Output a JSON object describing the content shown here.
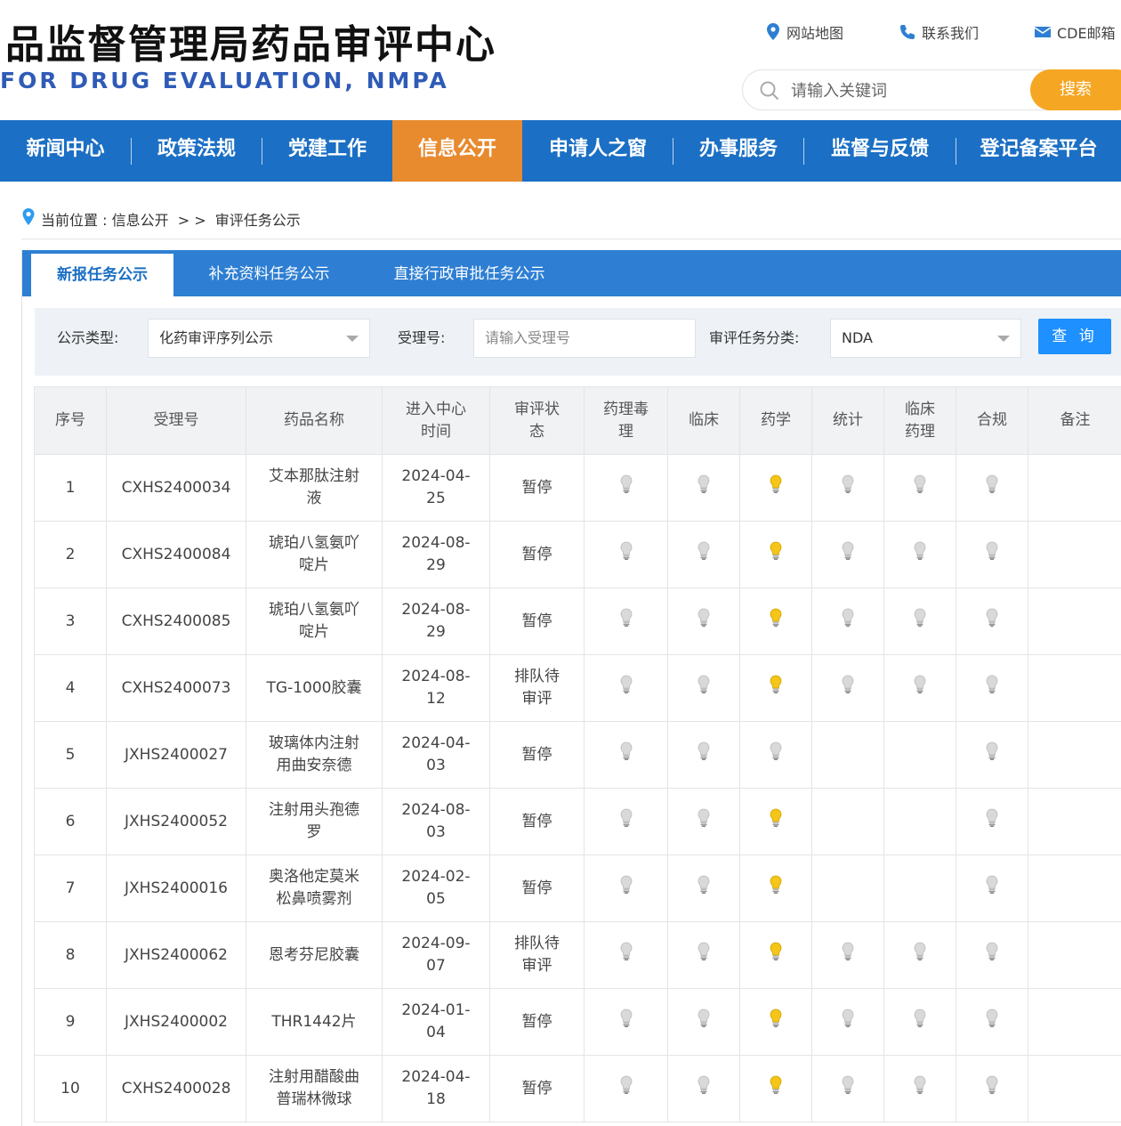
{
  "header": {
    "title_cn": "品监督管理局药品审评中心",
    "title_en": "FOR DRUG EVALUATION, NMPA",
    "links": {
      "sitemap": "网站地图",
      "contact": "联系我们",
      "mail": "CDE邮箱"
    },
    "search_placeholder": "请输入关键词",
    "search_button": "搜索"
  },
  "nav": {
    "items": [
      "新闻中心",
      "政策法规",
      "党建工作",
      "信息公开",
      "申请人之窗",
      "办事服务",
      "监督与反馈",
      "登记备案平台"
    ],
    "active": "信息公开"
  },
  "breadcrumb": {
    "text": "当前位置 : 信息公开  > >  审评任务公示"
  },
  "tabs": {
    "items": [
      "新报任务公示",
      "补充资料任务公示",
      "直接行政审批任务公示"
    ],
    "active": "新报任务公示"
  },
  "filter": {
    "type_label": "公示类型:",
    "type_value": "化药审评序列公示",
    "acceptance_label": "受理号:",
    "acceptance_placeholder": "请输入受理号",
    "category_label": "审评任务分类:",
    "category_value": "NDA",
    "query_button": "查 询"
  },
  "colors": {
    "nav_blue": "#1b6fc4",
    "nav_active": "#e88a2e",
    "search_button": "#f5a623",
    "bulb_on": "#f5c518",
    "bulb_off": "#d9d9d9"
  },
  "table": {
    "headers": [
      "序号",
      "受理号",
      "药品名称",
      "进入中心\n时间",
      "审评状\n态",
      "药理毒\n理",
      "临床",
      "药学",
      "统计",
      "临床\n药理",
      "合规",
      "备注"
    ],
    "rows": [
      {
        "no": "1",
        "id": "CXHS2400034",
        "name": "艾本那肽注射\n液",
        "date": "2024-04-\n25",
        "status": "暂停",
        "bulbs": [
          "off",
          "off",
          "on",
          "off",
          "off",
          "off"
        ],
        "note": ""
      },
      {
        "no": "2",
        "id": "CXHS2400084",
        "name": "琥珀八氢氨吖\n啶片",
        "date": "2024-08-\n29",
        "status": "暂停",
        "bulbs": [
          "off",
          "off",
          "on",
          "off",
          "off",
          "off"
        ],
        "note": ""
      },
      {
        "no": "3",
        "id": "CXHS2400085",
        "name": "琥珀八氢氨吖\n啶片",
        "date": "2024-08-\n29",
        "status": "暂停",
        "bulbs": [
          "off",
          "off",
          "on",
          "off",
          "off",
          "off"
        ],
        "note": ""
      },
      {
        "no": "4",
        "id": "CXHS2400073",
        "name": "TG-1000胶囊",
        "date": "2024-08-\n12",
        "status": "排队待\n审评",
        "bulbs": [
          "off",
          "off",
          "on",
          "off",
          "off",
          "off"
        ],
        "note": ""
      },
      {
        "no": "5",
        "id": "JXHS2400027",
        "name": "玻璃体内注射\n用曲安奈德",
        "date": "2024-04-\n03",
        "status": "暂停",
        "bulbs": [
          "off",
          "off",
          "off",
          "",
          "",
          "off"
        ],
        "note": ""
      },
      {
        "no": "6",
        "id": "JXHS2400052",
        "name": "注射用头孢德\n罗",
        "date": "2024-08-\n03",
        "status": "暂停",
        "bulbs": [
          "off",
          "off",
          "on",
          "",
          "",
          "off"
        ],
        "note": ""
      },
      {
        "no": "7",
        "id": "JXHS2400016",
        "name": "奥洛他定莫米\n松鼻喷雾剂",
        "date": "2024-02-\n05",
        "status": "暂停",
        "bulbs": [
          "off",
          "off",
          "on",
          "",
          "",
          "off"
        ],
        "note": ""
      },
      {
        "no": "8",
        "id": "JXHS2400062",
        "name": "恩考芬尼胶囊",
        "date": "2024-09-\n07",
        "status": "排队待\n审评",
        "bulbs": [
          "off",
          "off",
          "on",
          "off",
          "off",
          "off"
        ],
        "note": ""
      },
      {
        "no": "9",
        "id": "JXHS2400002",
        "name": "THR1442片",
        "date": "2024-01-\n04",
        "status": "暂停",
        "bulbs": [
          "off",
          "off",
          "on",
          "off",
          "off",
          "off"
        ],
        "note": ""
      },
      {
        "no": "10",
        "id": "CXHS2400028",
        "name": "注射用醋酸曲\n普瑞林微球",
        "date": "2024-04-\n18",
        "status": "暂停",
        "bulbs": [
          "off",
          "off",
          "on",
          "off",
          "off",
          "off"
        ],
        "note": ""
      }
    ]
  }
}
